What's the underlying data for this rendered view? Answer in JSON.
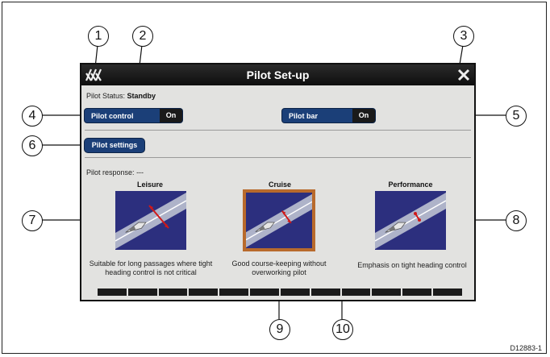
{
  "dialog": {
    "title": "Pilot Set-up",
    "back_icon": "back-chevrons-icon",
    "close_icon": "close-x-icon"
  },
  "status": {
    "label": "Pilot Status:",
    "value": "Standby"
  },
  "pilot_control": {
    "label": "Pilot control",
    "value": "On"
  },
  "pilot_bar": {
    "label": "Pilot bar",
    "value": "On"
  },
  "pilot_settings": {
    "label": "Pilot settings"
  },
  "response": {
    "label": "Pilot response:",
    "value": "---"
  },
  "modes": [
    {
      "title": "Leisure",
      "desc1": "Suitable for long passages where tight",
      "desc2": "heading control is not critical",
      "selected": false
    },
    {
      "title": "Cruise",
      "desc1": "Good course-keeping without",
      "desc2": "overworking pilot",
      "selected": true
    },
    {
      "title": "Performance",
      "desc1": "Emphasis on tight heading control",
      "desc2": "",
      "selected": false
    }
  ],
  "callouts": [
    "1",
    "2",
    "3",
    "4",
    "5",
    "6",
    "7",
    "8",
    "9",
    "10"
  ],
  "doc_code": "D12883-1",
  "colors": {
    "button_blue": "#1b3f78",
    "selection": "#b86a2c",
    "screen_bg": "#e2e2e0"
  }
}
